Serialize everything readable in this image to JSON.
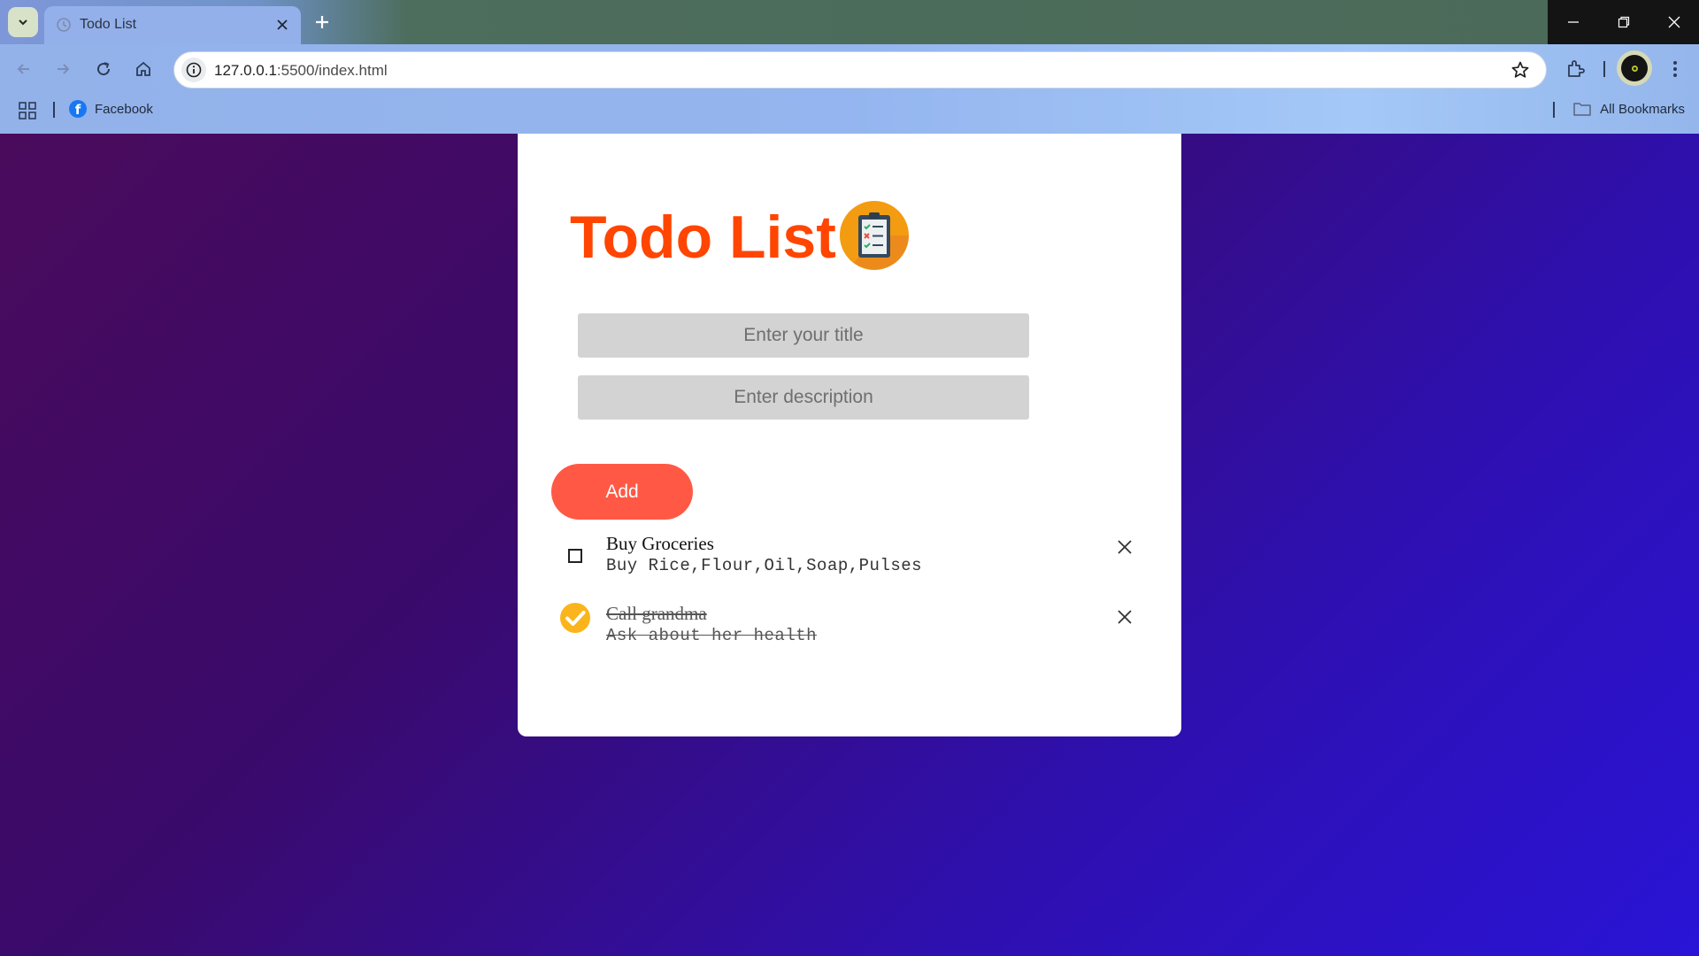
{
  "browser": {
    "tab": {
      "title": "Todo List"
    },
    "address_bar": {
      "host": "127.0.0.1",
      "rest": ":5500/index.html"
    },
    "bookmarks": [
      {
        "label": "Facebook",
        "icon": "facebook-icon"
      }
    ],
    "all_bookmarks_label": "All Bookmarks"
  },
  "app": {
    "title": "Todo List",
    "title_color": "#ff4500",
    "title_input": {
      "placeholder": "Enter your title",
      "value": ""
    },
    "description_input": {
      "placeholder": "Enter description",
      "value": ""
    },
    "add_label": "Add",
    "accent": "#ff5945",
    "todos": [
      {
        "title": "Buy Groceries",
        "description": "Buy Rice,Flour,Oil,Soap,Pulses",
        "completed": false
      },
      {
        "title": "Call grandma",
        "description": "Ask about her health",
        "completed": true
      }
    ]
  }
}
